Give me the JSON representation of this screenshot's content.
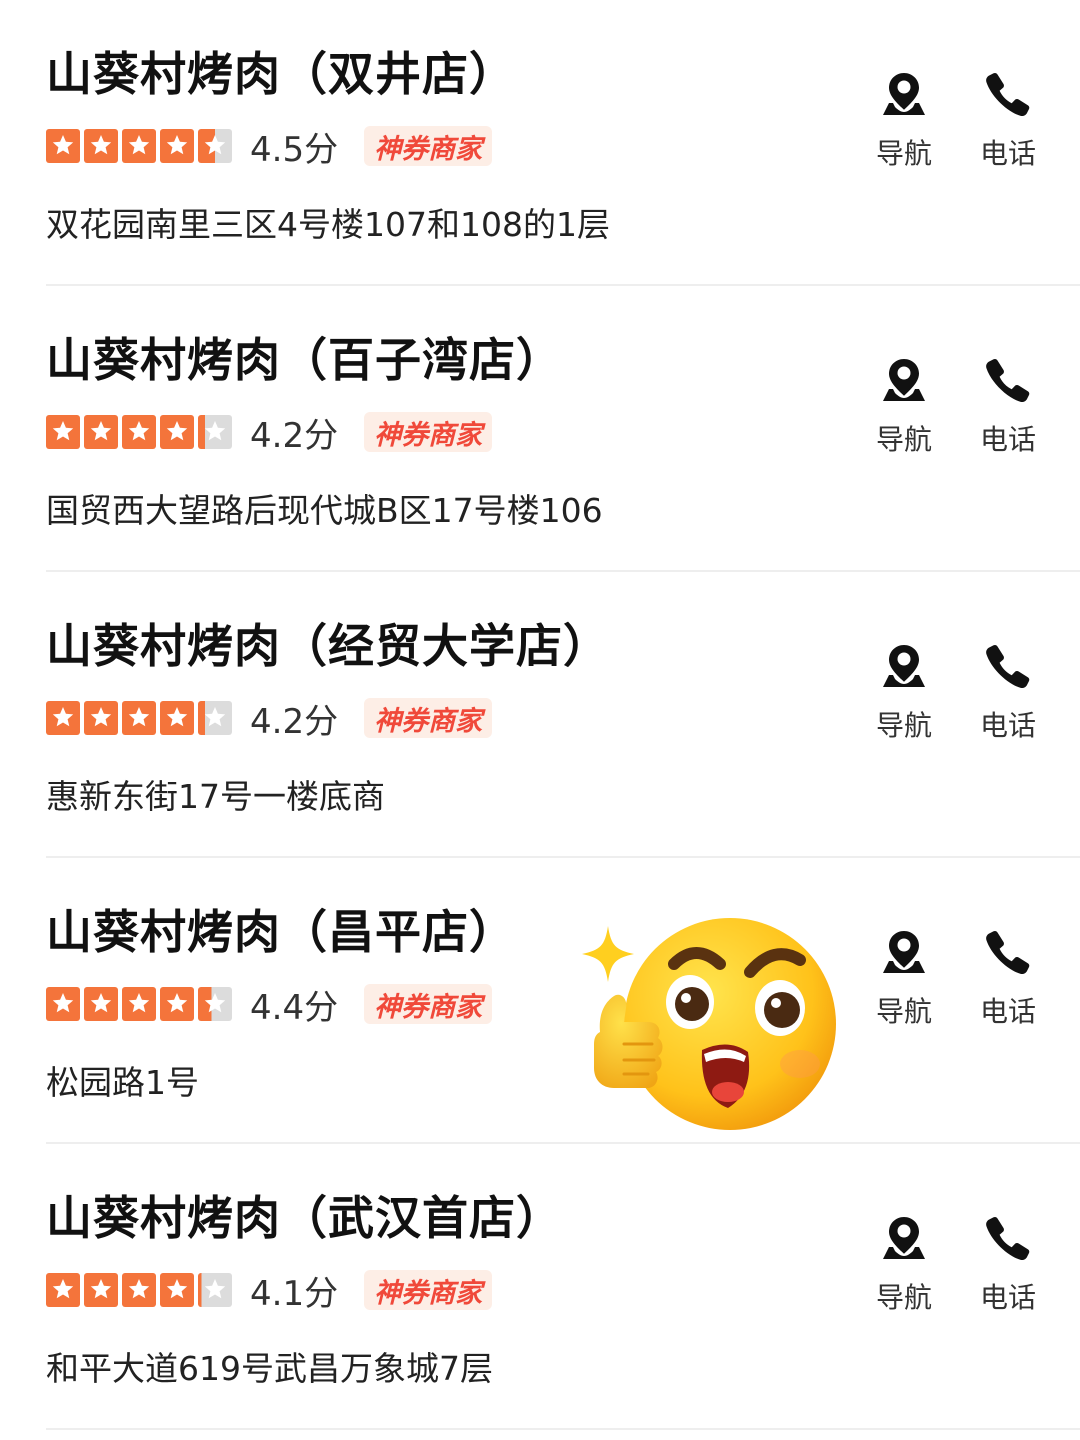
{
  "colors": {
    "star_active": "#f4743b",
    "star_inactive": "#dcdcdc",
    "badge_bg": "#fdeee6",
    "badge_text": "#f0493a",
    "divider": "#eeeeee"
  },
  "actions": {
    "navigate_label": "导航",
    "call_label": "电话"
  },
  "stores": [
    {
      "name": "山葵村烤肉（双井店）",
      "rating": 4.5,
      "score_text": "4.5分",
      "badge": "神券商家",
      "address": "双花园南里三区4号楼107和108的1层"
    },
    {
      "name": "山葵村烤肉（百子湾店）",
      "rating": 4.2,
      "score_text": "4.2分",
      "badge": "神券商家",
      "address": "国贸西大望路后现代城B区17号楼106"
    },
    {
      "name": "山葵村烤肉（经贸大学店）",
      "rating": 4.2,
      "score_text": "4.2分",
      "badge": "神券商家",
      "address": "惠新东街17号一楼底商"
    },
    {
      "name": "山葵村烤肉（昌平店）",
      "rating": 4.4,
      "score_text": "4.4分",
      "badge": "神券商家",
      "address": "松园路1号"
    },
    {
      "name": "山葵村烤肉（武汉首店）",
      "rating": 4.1,
      "score_text": "4.1分",
      "badge": "神券商家",
      "address": "和平大道619号武昌万象城7层"
    }
  ],
  "decoration": {
    "sticker_icon": "thumbs-up-surprised-emoji-icon"
  }
}
